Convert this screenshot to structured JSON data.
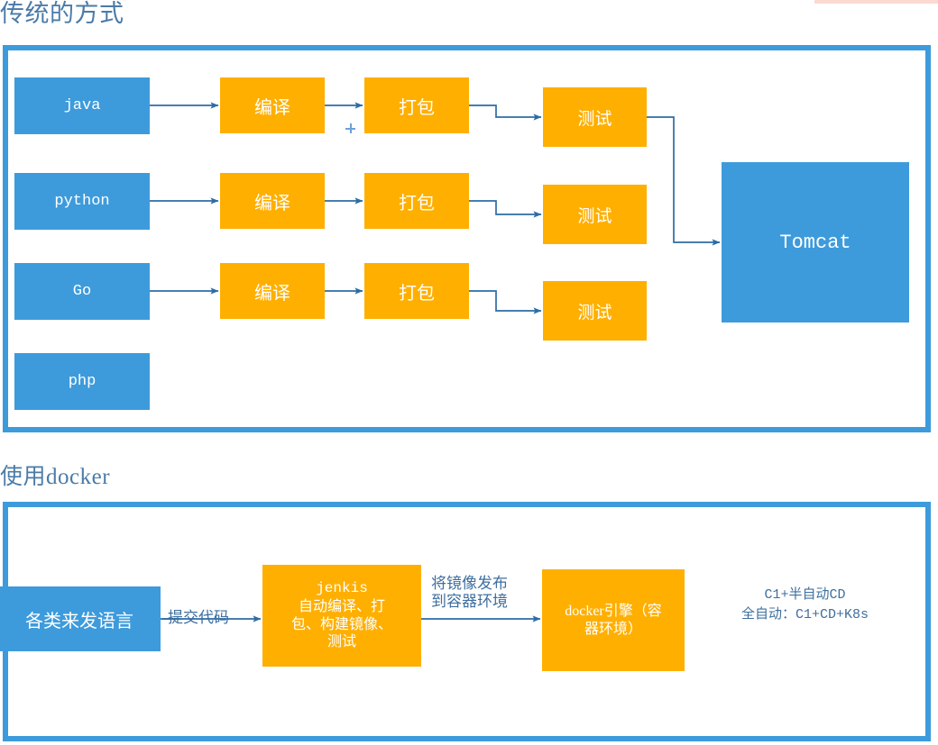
{
  "page": {
    "background": "#ffffff",
    "accent_blue": "#3d9bdc",
    "accent_orange": "#ffaf00",
    "text_blue": "#4a7ba8"
  },
  "sections": {
    "traditional": {
      "title": "传统的方式",
      "languages": [
        {
          "label": "java"
        },
        {
          "label": "python"
        },
        {
          "label": "Go"
        },
        {
          "label": "php"
        }
      ],
      "compile_label": "编译",
      "package_label": "打包",
      "test_label": "测试",
      "rows": [
        {
          "language": "java",
          "compile": "编译",
          "package": "打包",
          "test": "测试"
        },
        {
          "language": "python",
          "compile": "编译",
          "package": "打包",
          "test": "测试"
        },
        {
          "language": "Go",
          "compile": "编译",
          "package": "打包",
          "test": "测试"
        }
      ],
      "target": "Tomcat"
    },
    "docker": {
      "title": "使用docker",
      "source": "各类来发语言",
      "commit_label": "提交代码",
      "jenkis": {
        "line1": "jenkis",
        "line2": "自动编译、打",
        "line3": "包、构建镜像、",
        "line4": "测试"
      },
      "publish_label_line1": "将镜像发布",
      "publish_label_line2": "到容器环境",
      "engine": {
        "line1": "docker引擎（容",
        "line2": "器环境）"
      },
      "note": {
        "line1": "C1+半自动CD",
        "line2": "全自动：C1+CD+K8s"
      }
    }
  }
}
